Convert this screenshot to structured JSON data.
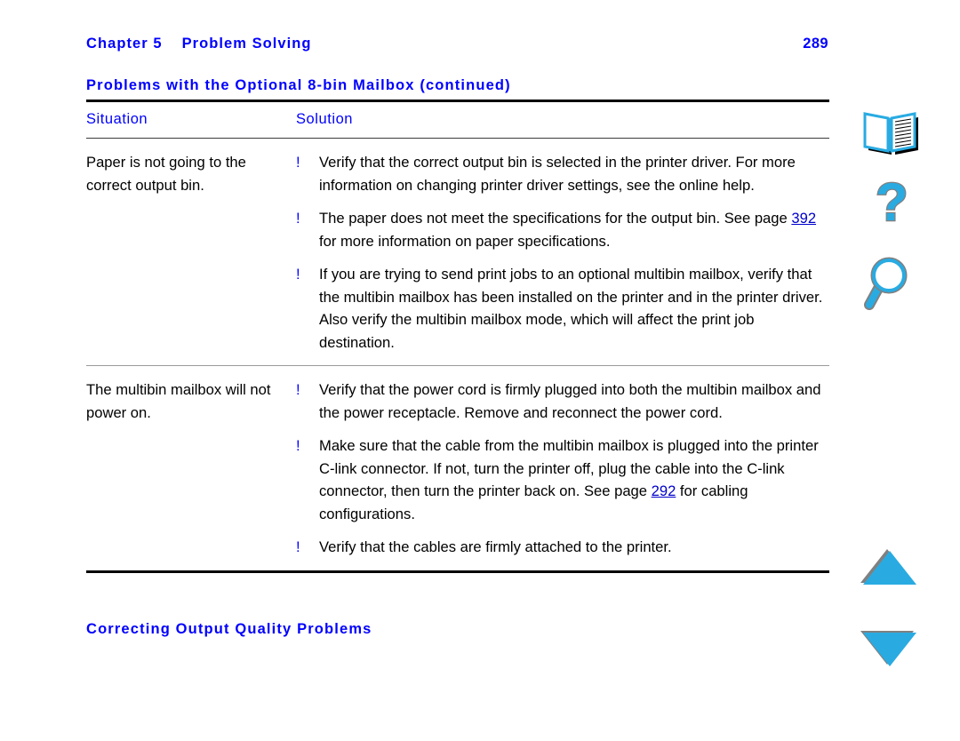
{
  "header": {
    "chapter_label": "Chapter 5",
    "chapter_title": "Problem Solving",
    "page_number": "289"
  },
  "table": {
    "title": "Problems with the Optional 8-bin Mailbox (continued)",
    "columns": [
      "Situation",
      "Solution"
    ],
    "bullet_marker": "!",
    "rows": [
      {
        "situation": "Paper is not going to the correct output bin.",
        "solutions": [
          {
            "before": "Verify that the correct output bin is selected in the printer driver. For more information on changing printer driver settings, see the online help.",
            "link": "",
            "after": ""
          },
          {
            "before": "The paper does not meet the specifications for the output bin. See page ",
            "link": "392",
            "after": " for more information on paper specifications."
          },
          {
            "before": "If you are trying to send print jobs to an optional multibin mailbox, verify that the multibin mailbox has been installed on the printer and in the printer driver. Also verify the multibin mailbox mode, which will affect the print job destination.",
            "link": "",
            "after": ""
          }
        ]
      },
      {
        "situation": "The multibin mailbox will not power on.",
        "solutions": [
          {
            "before": "Verify that the power cord is firmly plugged into both the multibin mailbox and the power receptacle. Remove and reconnect the power cord.",
            "link": "",
            "after": ""
          },
          {
            "before": "Make sure that the cable from the multibin mailbox is plugged into the printer C-link connector. If not, turn the printer off, plug the cable into the C-link connector, then turn the printer back on. See page ",
            "link": "292",
            "after": " for cabling configurations."
          },
          {
            "before": "Verify that the cables are firmly attached to the printer.",
            "link": "",
            "after": ""
          }
        ]
      }
    ]
  },
  "section_heading": "Correcting Output Quality Problems",
  "navigation": {
    "items": [
      {
        "name": "contents",
        "icon": "open-book-icon"
      },
      {
        "name": "help",
        "icon": "question-mark-icon"
      },
      {
        "name": "search",
        "icon": "magnifier-icon"
      },
      {
        "name": "previous-page",
        "icon": "triangle-up-icon"
      },
      {
        "name": "next-page",
        "icon": "triangle-down-icon"
      }
    ]
  },
  "colors": {
    "link_blue": "#0000ff",
    "icon_cyan": "#29ABE2",
    "icon_shadow": "#808080",
    "rule_black": "#000000",
    "rule_gray": "#9a9a9a"
  }
}
